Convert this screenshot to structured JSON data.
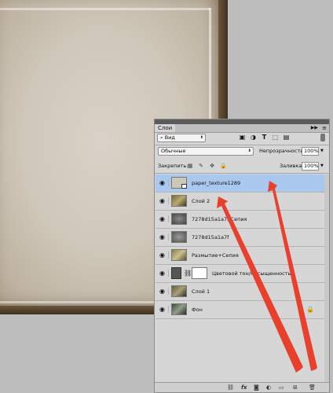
{
  "canvas": {
    "description": ""
  },
  "panel": {
    "tab_label": "Слои",
    "filter": {
      "value": "Вид"
    },
    "blend_mode": {
      "value": "Обычные"
    },
    "opacity": {
      "label": "Непрозрачность:",
      "value": "100%"
    },
    "lock": {
      "label": "Закрепить:"
    },
    "fill": {
      "label": "Заливка:",
      "value": "100%"
    },
    "layers": [
      {
        "name": "paper_texture1289",
        "selected": true,
        "thumb": "paper",
        "smart": true
      },
      {
        "name": "Слой 2",
        "selected": false,
        "thumb": "photo"
      },
      {
        "name": "7278d15a1a7f Сепия",
        "selected": false,
        "thumb": "gray"
      },
      {
        "name": "7278d15a1a7f",
        "selected": false,
        "thumb": "gray"
      },
      {
        "name": "Размытие+Сепия",
        "selected": false,
        "thumb": "photo"
      },
      {
        "name": "Цветовой тон/Насыщенность",
        "selected": false,
        "thumb": "adjust"
      },
      {
        "name": "Слой 1",
        "selected": false,
        "thumb": "photo"
      },
      {
        "name": "Фон",
        "selected": false,
        "thumb": "photo2",
        "locked": true
      }
    ]
  },
  "colors": {
    "selection": "#aac7ee",
    "arrow": "#e8402c"
  }
}
